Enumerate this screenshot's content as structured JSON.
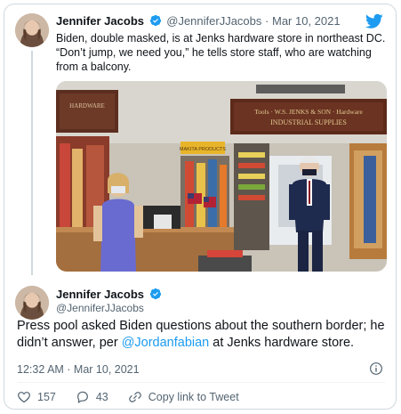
{
  "quoted_tweet": {
    "author_name": "Jennifer Jacobs",
    "handle": "@JenniferJJacobs",
    "separator": "·",
    "date": "Mar 10, 2021",
    "text": "Biden, double masked, is at Jenks hardware store in northeast DC. “Don’t jump, we need you,” he tells store staff, who are watching from a balcony.",
    "media": {
      "sign_left": "HARDWARE",
      "sign_right_line1": "Tools · W.S. JENKS & SON · Hardware",
      "sign_right_line2": "INDUSTRIAL SUPPLIES",
      "sign_yellow": "MAKITA PRODUCTS"
    }
  },
  "main_tweet": {
    "author_name": "Jennifer Jacobs",
    "handle": "@JenniferJJacobs",
    "text_before_link": "Press pool asked Biden questions about the southern border; he didn’t answer, per ",
    "link_text": "@Jordanfabian",
    "text_after_link": " at Jenks hardware store.",
    "timestamp": "12:32 AM · Mar 10, 2021"
  },
  "actions": {
    "likes": "157",
    "replies": "43",
    "copy_link": "Copy link to Tweet"
  },
  "colors": {
    "twitter_blue": "#1d9bf0",
    "like_red": "#f91880",
    "secondary_text": "#536471",
    "border": "#cfd9de"
  },
  "icons": [
    "verified-badge-icon",
    "twitter-bird-icon",
    "info-icon",
    "heart-icon",
    "reply-icon",
    "link-icon"
  ]
}
